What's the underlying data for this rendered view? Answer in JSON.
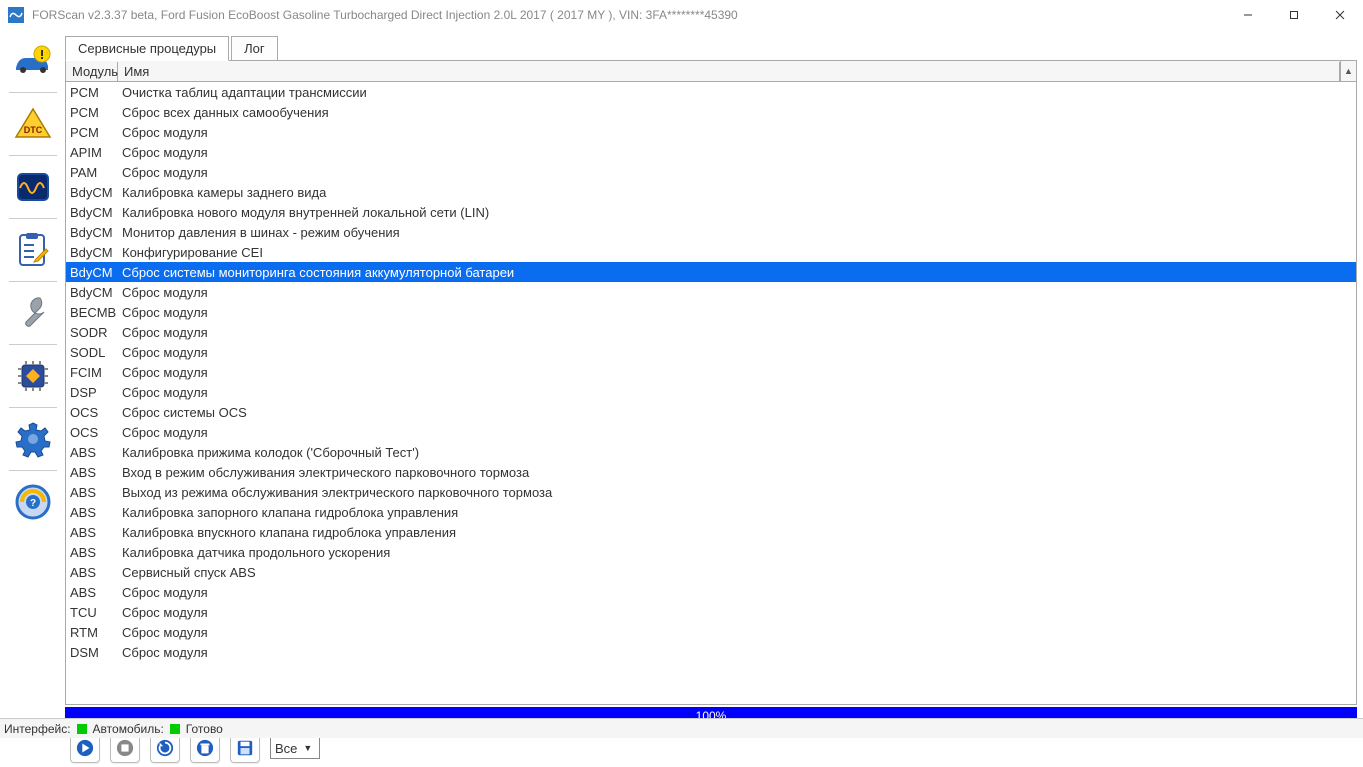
{
  "window": {
    "title": "FORScan v2.3.37 beta, Ford Fusion EcoBoost Gasoline Turbocharged Direct Injection 2.0L 2017 ( 2017 MY ), VIN: 3FA********45390"
  },
  "tabs": {
    "service": "Сервисные процедуры",
    "log": "Лог"
  },
  "columns": {
    "module": "Модуль",
    "name": "Имя"
  },
  "selected_index": 9,
  "rows": [
    {
      "module": "PCM",
      "name": "Очистка таблиц адаптации трансмиссии"
    },
    {
      "module": "PCM",
      "name": "Сброс всех данных самообучения"
    },
    {
      "module": "PCM",
      "name": "Сброс модуля"
    },
    {
      "module": "APIM",
      "name": "Сброс модуля"
    },
    {
      "module": "PAM",
      "name": "Сброс модуля"
    },
    {
      "module": "BdyCM",
      "name": "Калибровка камеры заднего вида"
    },
    {
      "module": "BdyCM",
      "name": "Калибровка нового модуля внутренней локальной сети (LIN)"
    },
    {
      "module": "BdyCM",
      "name": "Монитор давления в шинах - режим обучения"
    },
    {
      "module": "BdyCM",
      "name": "Конфигурирование CEI"
    },
    {
      "module": "BdyCM",
      "name": "Сброс системы мониторинга состояния аккумуляторной батареи"
    },
    {
      "module": "BdyCM",
      "name": "Сброс модуля"
    },
    {
      "module": "BECMB",
      "name": "Сброс модуля"
    },
    {
      "module": "SODR",
      "name": "Сброс модуля"
    },
    {
      "module": "SODL",
      "name": "Сброс модуля"
    },
    {
      "module": "FCIM",
      "name": "Сброс модуля"
    },
    {
      "module": "DSP",
      "name": "Сброс модуля"
    },
    {
      "module": "OCS",
      "name": "Сброс системы OCS"
    },
    {
      "module": "OCS",
      "name": "Сброс модуля"
    },
    {
      "module": "ABS",
      "name": "Калибровка прижима колодок ('Сборочный Тест')"
    },
    {
      "module": "ABS",
      "name": "Вход в режим обслуживания электрического парковочного тормоза"
    },
    {
      "module": "ABS",
      "name": "Выход из режима обслуживания электрического парковочного тормоза"
    },
    {
      "module": "ABS",
      "name": "Калибровка запорного клапана гидроблока управления"
    },
    {
      "module": "ABS",
      "name": "Калибровка впускного клапана гидроблока управления"
    },
    {
      "module": "ABS",
      "name": "Калибровка датчика продольного ускорения"
    },
    {
      "module": "ABS",
      "name": "Сервисный спуск ABS"
    },
    {
      "module": "ABS",
      "name": "Сброс модуля"
    },
    {
      "module": "TCU",
      "name": "Сброс модуля"
    },
    {
      "module": "RTM",
      "name": "Сброс модуля"
    },
    {
      "module": "DSM",
      "name": "Сброс модуля"
    }
  ],
  "progress": {
    "text": "100%"
  },
  "filter": {
    "selected": "Все"
  },
  "status": {
    "interface_label": "Интерфейс:",
    "vehicle_label": "Автомобиль:",
    "ready": "Готово"
  }
}
